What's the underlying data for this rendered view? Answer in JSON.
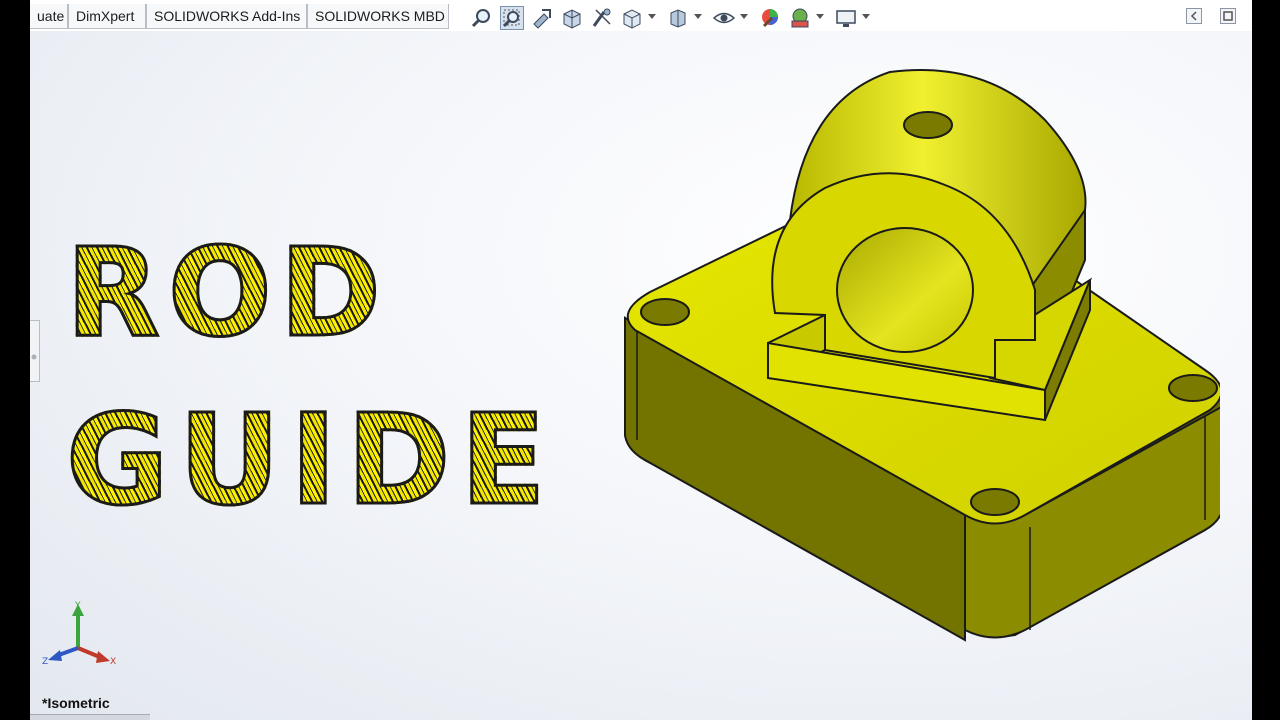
{
  "tabs": [
    {
      "label": "uate"
    },
    {
      "label": "DimXpert"
    },
    {
      "label": "SOLIDWORKS Add-Ins"
    },
    {
      "label": "SOLIDWORKS MBD"
    }
  ],
  "toolbar": {
    "icons": [
      "zoom-to-fit-icon",
      "zoom-to-area-icon",
      "previous-view-icon",
      "section-view-icon",
      "dynamic-annotation-icon",
      "view-orientation-icon",
      "display-style-icon",
      "hide-show-items-icon",
      "edit-appearance-icon",
      "apply-scene-icon",
      "view-settings-icon"
    ]
  },
  "title": {
    "line1": "ROD",
    "line2": "GUIDE"
  },
  "triad": {
    "x": "X",
    "y": "Y",
    "z": "Z"
  },
  "viewport": {
    "view_name": "*Isometric",
    "part_color": "#d8d800",
    "background_top": "#ffffff",
    "background_bottom": "#e3e8ef"
  }
}
